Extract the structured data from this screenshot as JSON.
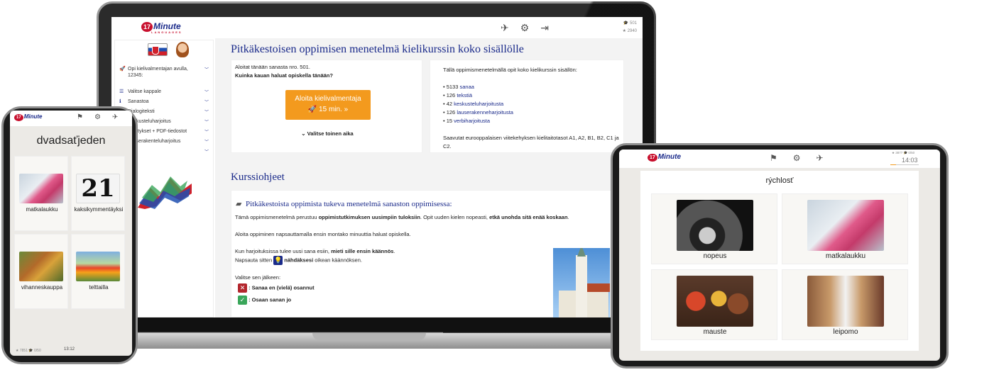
{
  "brand": {
    "logo_number": "17",
    "logo_word": "Minute",
    "logo_sub": "LANGUAGES"
  },
  "laptop": {
    "stats": {
      "learned": "501",
      "points": "2940"
    },
    "top_icons": [
      "no-distraction-icon",
      "gear-icon",
      "logout-icon"
    ],
    "sidebar": {
      "items": [
        {
          "icon": "rocket-icon",
          "label": "Opi kielivalmentajan avulla, 12345:"
        },
        {
          "icon": "list-icon",
          "label": "Valitse kappale"
        },
        {
          "icon": "vocab-icon",
          "label": "Sanastoa"
        },
        {
          "icon": "dialog-icon",
          "label": "Dialogiteksti"
        },
        {
          "icon": "chat-icon",
          "label": "Keskusteluharjoitus"
        },
        {
          "icon": "audio-icon",
          "label": "Äänitykset + PDF-tiedostot"
        },
        {
          "icon": "sentence-icon",
          "label": "Lauserakenteluharjoitus"
        },
        {
          "icon": "more-icon",
          "label": ""
        }
      ]
    },
    "main_title": "Pitkäkestoisen oppimisen menetelmä kielikurssin koko sisällölle",
    "start_card": {
      "line1": "Aloitat tänään sanasta nro. 501.",
      "line2": "Kuinka kauan haluat opiskella tänään?",
      "button_line1": "Aloita kielivalmentaja",
      "button_line2": "🚀 15 min. »",
      "other_time": "Valitse toinen aika"
    },
    "content_card": {
      "intro": "Tällä oppimismenetelmällä opit koko kielikurssin sisällön:",
      "items": [
        {
          "count": "• 5133",
          "label": "sanaa"
        },
        {
          "count": "• 126",
          "label": "tekstiä"
        },
        {
          "count": "• 42",
          "label": "keskusteluharjoitusta"
        },
        {
          "count": "• 126",
          "label": "lauserakenneharjoitusta"
        },
        {
          "count": "• 15",
          "label": "verbiharjoitusta"
        }
      ],
      "outro": "Saavutat eurooppalaisen viitekehyksen kielitaitotasot A1, A2, B1, B2, C1 ja C2."
    },
    "section_title": "Kurssiohjeet",
    "instructions": {
      "heading": "Pitkäkestoista oppimista tukeva menetelmä sanaston oppimisessa:",
      "p1_a": "Tämä oppimismenetelmä perustuu ",
      "p1_b": "oppimistutkimuksen uusimpiin tuloksiin",
      "p1_c": ". Opit uuden kielen nopeasti, ",
      "p1_d": "etkä unohda sitä enää koskaan",
      "p1_e": ".",
      "p2": "Aloita oppiminen napsauttamalla ensin montako minuuttia haluat opiskella.",
      "p3_a": "Kun harjoituksissa tulee uusi sana esiin, ",
      "p3_b": "mieti sille ensin käännös",
      "p3_c": ".",
      "p4_a": "Napsauta sitten ",
      "p4_b": "nähdäksesi",
      "p4_c": " oikean käännöksen.",
      "p5": "Valitse sen jälkeen:",
      "opt_wrong": ": Sanaa en (vielä) osannut",
      "opt_right": ": Osaan sanan jo"
    }
  },
  "phone": {
    "word": "dvadsaťjeden",
    "tiles": [
      {
        "label": "matkalaukku",
        "image": "suitcase"
      },
      {
        "label": "kaksikymmentäyksi",
        "image": "number-21",
        "number": "21"
      },
      {
        "label": "vihanneskauppa",
        "image": "vegetable-shop"
      },
      {
        "label": "telttailla",
        "image": "tent"
      }
    ],
    "status": "★ 7851  🎓 0/50",
    "time": "13:12"
  },
  "tablet": {
    "word": "rýchlosť",
    "stats": "★ 3877  🎓 0/50",
    "time": "14:03",
    "tiles": [
      {
        "label": "nopeus",
        "image": "speedometer"
      },
      {
        "label": "matkalaukku",
        "image": "suitcase"
      },
      {
        "label": "mauste",
        "image": "spices"
      },
      {
        "label": "leipomo",
        "image": "bakery"
      }
    ]
  },
  "colors": {
    "brand_blue": "#1a2a8a",
    "brand_red": "#c8102e",
    "accent_orange": "#f39a1e",
    "wrong_red": "#b3262d",
    "right_green": "#3aa65a"
  }
}
